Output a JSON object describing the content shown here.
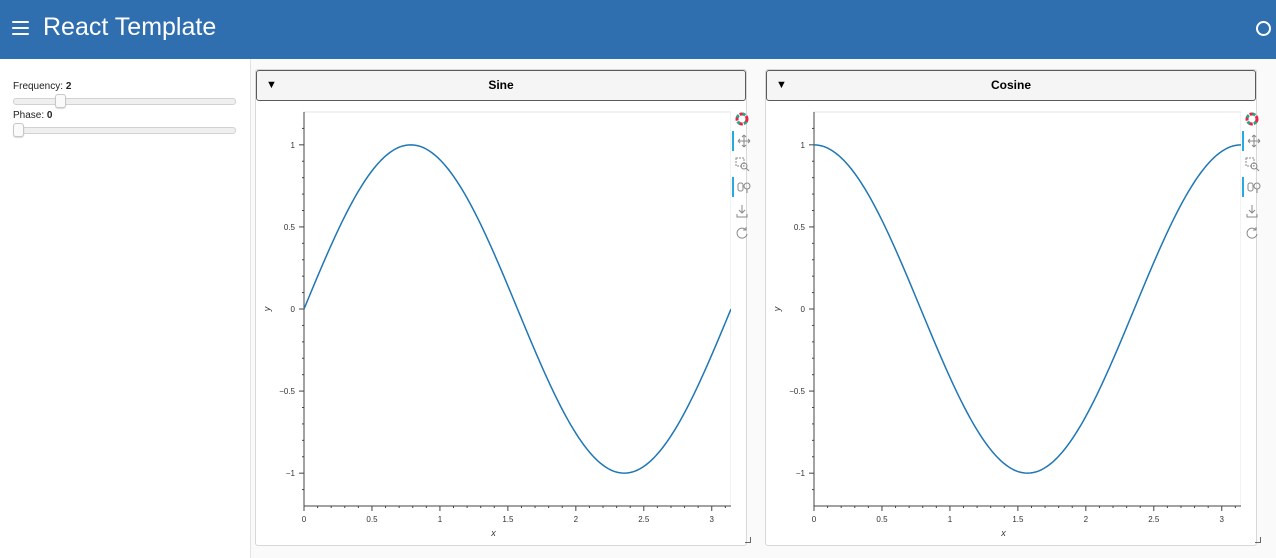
{
  "header": {
    "title": "React Template"
  },
  "sidebar": {
    "frequency": {
      "label": "Frequency: ",
      "value": "2",
      "fraction": 0.2
    },
    "phase": {
      "label": "Phase: ",
      "value": "0",
      "fraction": 0.0
    }
  },
  "cards": [
    {
      "title": "Sine",
      "collapse_glyph": "▼",
      "chart_data": {
        "type": "line",
        "function": "sin",
        "frequency": 2,
        "phase": 0,
        "xlabel": "x",
        "ylabel": "y",
        "xlim": [
          0,
          3.14159
        ],
        "ylim": [
          -1.2,
          1.2
        ],
        "x_ticks": [
          "0",
          "0.5",
          "1",
          "1.5",
          "2",
          "2.5",
          "3"
        ],
        "y_ticks": [
          "1",
          "0.5",
          "0",
          "−0.5",
          "−1"
        ],
        "series": [
          {
            "color": "#1f77b4",
            "x": [
              0,
              0.3927,
              0.7854,
              1.1781,
              1.5708,
              1.9635,
              2.3562,
              2.7489,
              3.1416
            ],
            "y": [
              0,
              0.707,
              1,
              0.707,
              0,
              -0.707,
              -1,
              -0.707,
              0
            ]
          }
        ]
      }
    },
    {
      "title": "Cosine",
      "collapse_glyph": "▼",
      "chart_data": {
        "type": "line",
        "function": "cos",
        "frequency": 2,
        "phase": 0,
        "xlabel": "x",
        "ylabel": "y",
        "xlim": [
          0,
          3.14159
        ],
        "ylim": [
          -1.2,
          1.2
        ],
        "x_ticks": [
          "0",
          "0.5",
          "1",
          "1.5",
          "2",
          "2.5",
          "3"
        ],
        "y_ticks": [
          "1",
          "0.5",
          "0",
          "−0.5",
          "−1"
        ],
        "series": [
          {
            "color": "#1f77b4",
            "x": [
              0,
              0.3927,
              0.7854,
              1.1781,
              1.5708,
              1.9635,
              2.3562,
              2.7489,
              3.1416
            ],
            "y": [
              1,
              0.707,
              0,
              -0.707,
              -1,
              -0.707,
              0,
              0.707,
              1
            ]
          }
        ]
      }
    }
  ],
  "toolbar": {
    "tools": [
      "bokeh-logo-icon",
      "pan-icon",
      "box-zoom-icon",
      "wheel-zoom-icon",
      "save-icon",
      "reset-icon"
    ],
    "active": [
      "pan-icon",
      "wheel-zoom-icon"
    ]
  },
  "colors": {
    "header": "#2f6fb0",
    "line": "#1f77b4",
    "toolbar_active": "#26aae1"
  }
}
